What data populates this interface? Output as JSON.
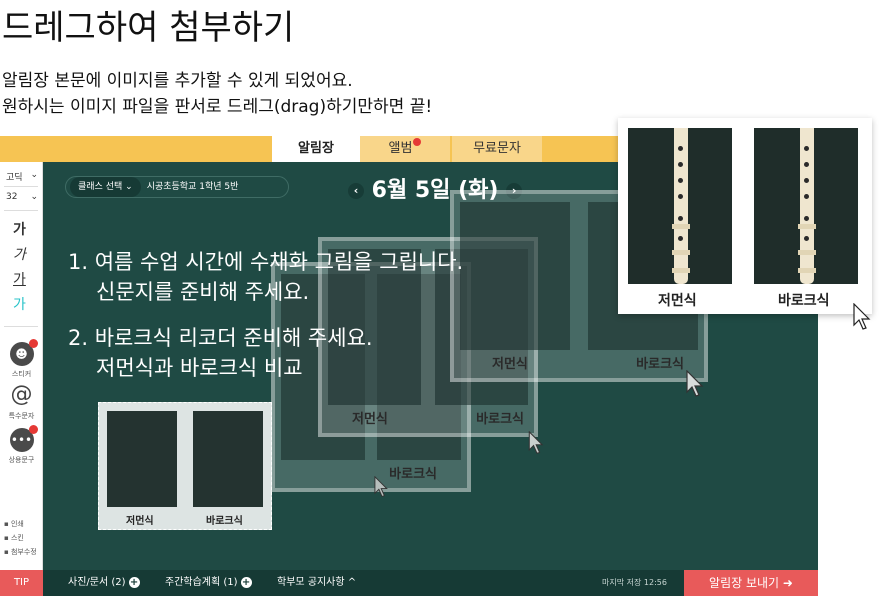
{
  "heading": "드레그하여 첨부하기",
  "description": {
    "line1": "알림장 본문에 이미지를 추가할 수 있게 되었어요.",
    "line2": "원하시는 이미지 파일을 판서로 드레그(drag)하기만하면 끝!"
  },
  "tabs": {
    "notice": "알림장",
    "album": "앨범",
    "sms": "무료문자"
  },
  "sidebar": {
    "font": "고딕",
    "size": "32",
    "glyph": "가",
    "sticker": "스티커",
    "special": "특수문자",
    "phrase": "상용문구",
    "print": "인쇄",
    "scan": "스킨",
    "attach": "첨부수정"
  },
  "board": {
    "class_chip": "클래스 선택",
    "class_name": "시공초등학교 1학년 5반",
    "date": "6월 5일 (화)",
    "line1": "1. 여름 수업 시간에 수채화 그림을 그립니다.",
    "line2": "신문지를 준비해 주세요.",
    "line3": "2. 바로크식 리코더 준비해 주세요.",
    "line4": "저먼식과 바로크식 비교"
  },
  "captions": {
    "german": "저먼식",
    "baroque": "바로크식"
  },
  "bottombar": {
    "tip": "TIP",
    "photo": "사진/문서 (2)",
    "weekly": "주간학습계획 (1)",
    "parent": "학부모 공지사항 ^",
    "saved": "마지막 저장 12:56",
    "send": "알림장 보내기 ➜"
  },
  "colors": {
    "board": "#1f4a44",
    "tabbar": "#f6c453",
    "accent": "#e85a5a"
  }
}
